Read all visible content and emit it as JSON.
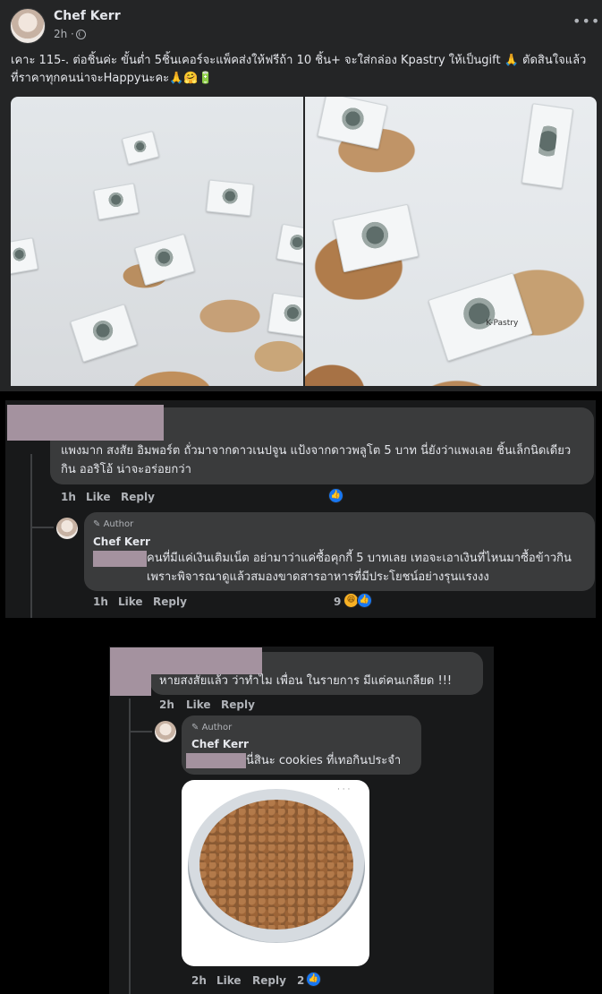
{
  "post": {
    "author": "Chef Kerr",
    "time": "2h ·",
    "more_icon": "more-horizontal-icon",
    "text": "เคาะ 115-. ต่อชิ้นค่ะ ขั้นต่ำ 5ชิ้นเคอร์จะแพ็คส่งให้ฟรีถ้า 10 ชิ้น+ จะใส่กล่อง Kpastry ให้เป็นgift 🙏 ตัดสินใจแล้วที่ราคาทุกคนน่าจะHappyนะคะ🙏🤗🔋",
    "photo_flag_text": "K-Pastry"
  },
  "comment1": {
    "text": "แพงมาก สงสัย อิมพอร์ต ถั่วมาจากดาวเนปจูน แป้งจากดาวพลูโต 5 บาท นี่ยังว่าแพงเลย ชิ้นเล็กนิดเดียว กิน ออริโอ้ น่าจะอร่อยกว่า",
    "time": "1h",
    "like": "Like",
    "reply": "Reply",
    "reply1": {
      "badge": "Author",
      "name": "Chef Kerr",
      "text": "คนที่มีแค่เงินเติมเน็ต อย่ามาว่าแค่ซื้อคุกกี้ 5 บาทเลย เทอจะเอาเงินที่ไหนมาซื้อข้าวกิน เพราะพิจารณาดูแล้วสมองขาดสารอาหารที่มีประโยชน์อย่างรุนแรงงง",
      "time": "1h",
      "like": "Like",
      "reply": "Reply",
      "reaction_count": "9"
    }
  },
  "comment2": {
    "text": "หายสงสัยแล้ว ว่าทำไม เพื่อน ในรายการ มีแต่คนเกลียด !!!",
    "time": "2h",
    "like": "Like",
    "reply": "Reply",
    "reply1": {
      "badge": "Author",
      "name": "Chef Kerr",
      "text": "นี่สินะ cookies ที่เทอกินประจำ",
      "image_dots": "· · ·",
      "time": "2h",
      "like": "Like",
      "reply": "Reply",
      "reaction_count": "2"
    }
  }
}
